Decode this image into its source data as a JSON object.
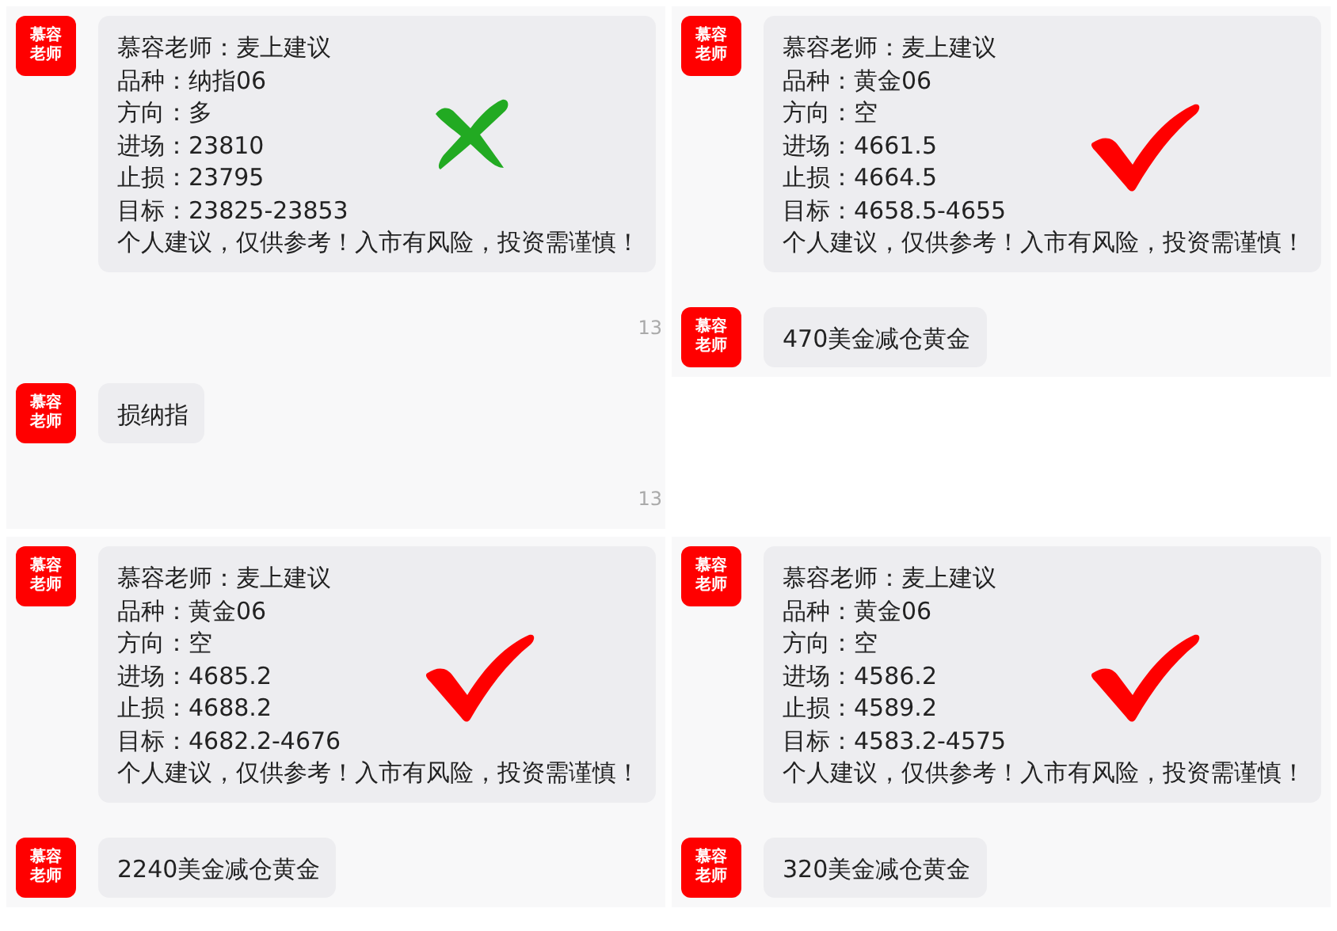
{
  "panels": [
    {
      "items": [
        {
          "kind": "message",
          "avatar": "慕容老师",
          "lines": [
            "慕容老师：麦上建议",
            "品种：纳指06",
            "方向：多",
            "进场：23810",
            "止损：23795",
            "目标：23825-23853",
            "个人建议，仅供参考！入市有风险，投资需谨慎！"
          ],
          "stamp": {
            "kind": "cross"
          }
        },
        {
          "kind": "time",
          "text": "13"
        },
        {
          "kind": "message",
          "avatar": "慕容老师",
          "lines": [
            "损纳指"
          ]
        },
        {
          "kind": "time",
          "text": "13"
        }
      ]
    },
    {
      "items": [
        {
          "kind": "message",
          "avatar": "慕容老师",
          "lines": [
            "慕容老师：麦上建议",
            "品种：黄金06",
            "方向：空",
            "进场：4661.5",
            "止损：4664.5",
            "目标：4658.5-4655",
            "个人建议，仅供参考！入市有风险，投资需谨慎！"
          ],
          "stamp": {
            "kind": "check"
          }
        },
        {
          "kind": "message",
          "avatar": "慕容老师",
          "lines": [
            "470美金减仓黄金"
          ]
        }
      ]
    },
    {
      "items": [
        {
          "kind": "message",
          "avatar": "慕容老师",
          "lines": [
            "慕容老师：麦上建议",
            "品种：黄金06",
            "方向：空",
            "进场：4685.2",
            "止损：4688.2",
            "目标：4682.2-4676",
            "个人建议，仅供参考！入市有风险，投资需谨慎！"
          ],
          "stamp": {
            "kind": "check"
          }
        },
        {
          "kind": "message",
          "avatar": "慕容老师",
          "lines": [
            "2240美金减仓黄金"
          ]
        }
      ]
    },
    {
      "items": [
        {
          "kind": "message",
          "avatar": "慕容老师",
          "lines": [
            "慕容老师：麦上建议",
            "品种：黄金06",
            "方向：空",
            "进场：4586.2",
            "止损：4589.2",
            "目标：4583.2-4575",
            "个人建议，仅供参考！入市有风险，投资需谨慎！"
          ],
          "stamp": {
            "kind": "check"
          }
        },
        {
          "kind": "message",
          "avatar": "慕容老师",
          "lines": [
            "320美金减仓黄金"
          ]
        }
      ]
    }
  ]
}
